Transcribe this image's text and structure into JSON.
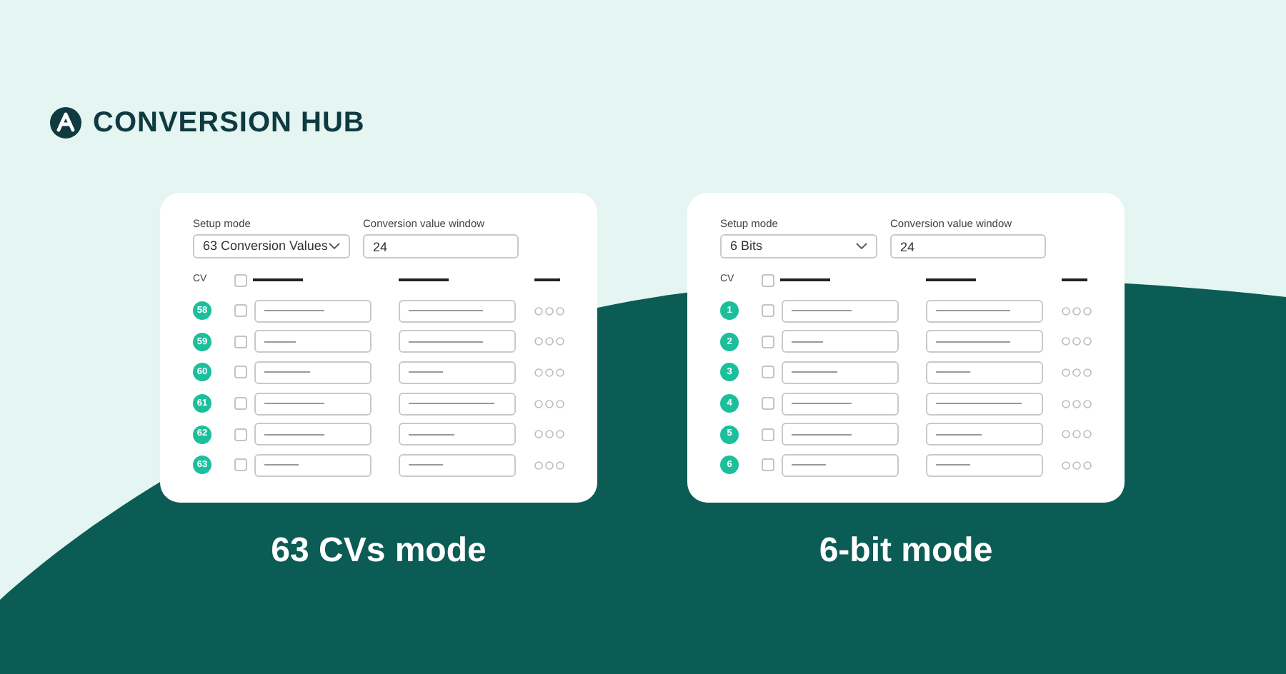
{
  "logo": {
    "text": "CONVERSION HUB"
  },
  "panels": [
    {
      "setup_label": "Setup mode",
      "setup_value": "63 Conversion Values",
      "window_label": "Conversion value window",
      "window_value": "24",
      "cv_header": "CV",
      "select_all_checked": false,
      "caption": "63 CVs mode",
      "rows": [
        {
          "cv": "58",
          "checked": false
        },
        {
          "cv": "59",
          "checked": false
        },
        {
          "cv": "60",
          "checked": false
        },
        {
          "cv": "61",
          "checked": false
        },
        {
          "cv": "62",
          "checked": false
        },
        {
          "cv": "63",
          "checked": false
        }
      ]
    },
    {
      "setup_label": "Setup mode",
      "setup_value": "6 Bits",
      "window_label": "Conversion value window",
      "window_value": "24",
      "cv_header": "CV",
      "select_all_checked": false,
      "caption": "6-bit mode",
      "rows": [
        {
          "cv": "1",
          "checked": false
        },
        {
          "cv": "2",
          "checked": false
        },
        {
          "cv": "3",
          "checked": false
        },
        {
          "cv": "4",
          "checked": false
        },
        {
          "cv": "5",
          "checked": false
        },
        {
          "cv": "6",
          "checked": false
        }
      ]
    }
  ]
}
